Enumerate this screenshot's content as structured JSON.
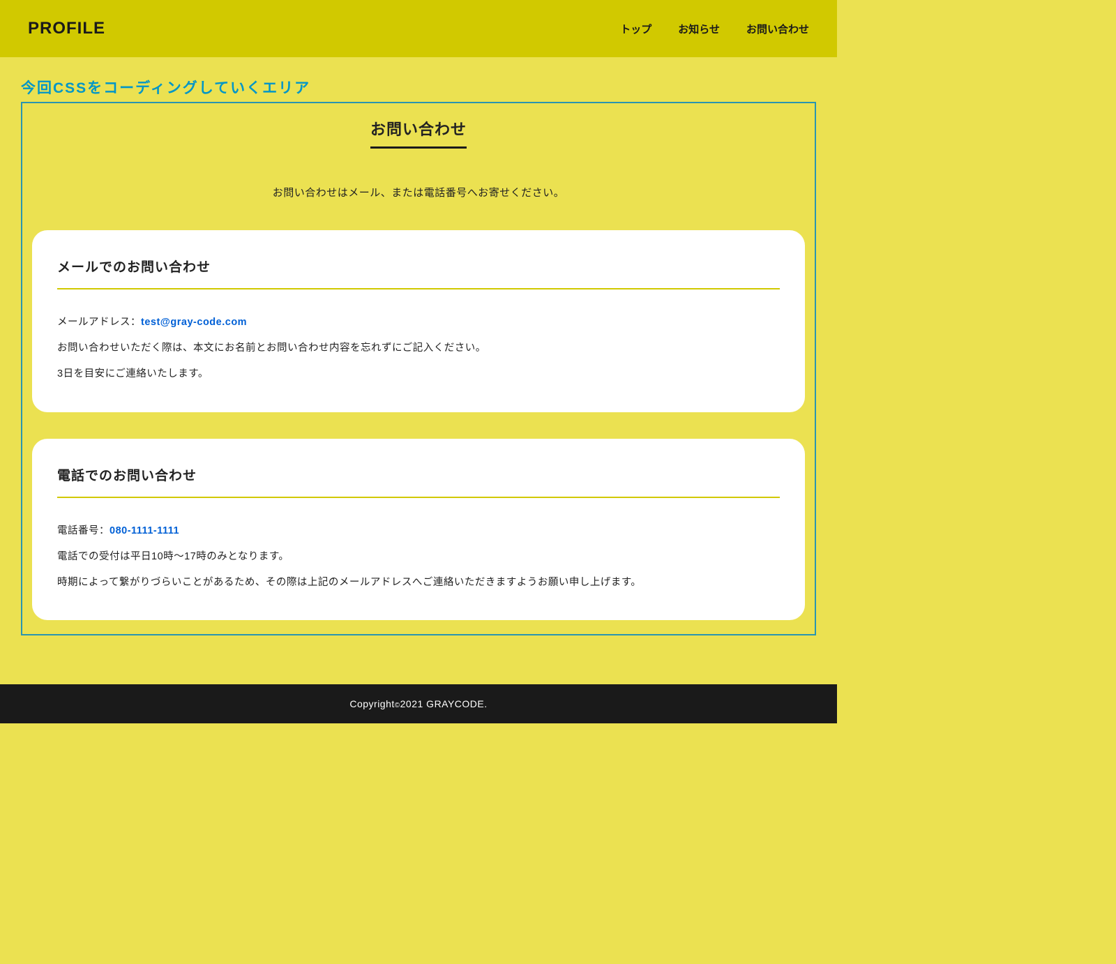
{
  "header": {
    "logo": "PROFILE",
    "nav": [
      {
        "label": "トップ"
      },
      {
        "label": "お知らせ"
      },
      {
        "label": "お問い合わせ"
      }
    ]
  },
  "area_label": "今回CSSをコーディングしていくエリア",
  "page": {
    "title": "お問い合わせ",
    "lead": "お問い合わせはメール、または電話番号へお寄せください。"
  },
  "sections": {
    "mail": {
      "heading": "メールでのお問い合わせ",
      "label": "メールアドレス：",
      "link_text": "test@gray-code.com",
      "p1": "お問い合わせいただく際は、本文にお名前とお問い合わせ内容を忘れずにご記入ください。",
      "p2": "3日を目安にご連絡いたします。"
    },
    "tel": {
      "heading": "電話でのお問い合わせ",
      "label": "電話番号：",
      "link_text": "080-1111-1111",
      "p1": "電話での受付は平日10時〜17時のみとなります。",
      "p2": "時期によって繋がりづらいことがあるため、その際は上記のメールアドレスへご連絡いただきますようお願い申し上げます。"
    }
  },
  "footer": {
    "prefix": "Copyright",
    "copy_symbol": "©",
    "rest": "2021 GRAYCODE."
  }
}
